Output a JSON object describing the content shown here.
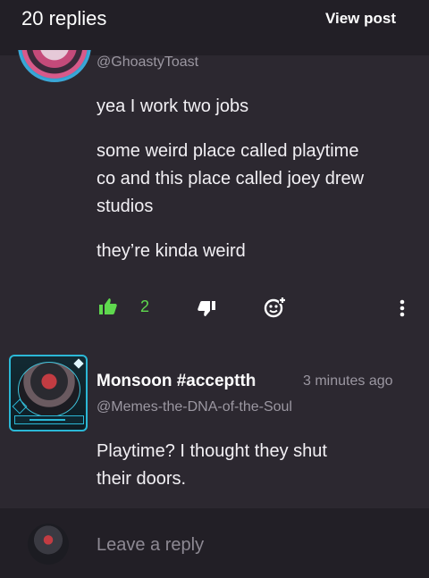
{
  "header": {
    "reply_count": "20 replies",
    "view_post_label": "View post"
  },
  "comment_1": {
    "handle": "@GhoastyToast",
    "paragraphs": [
      "yea I work two jobs",
      "some weird place called playtime",
      "co and this place called joey drew",
      "studios",
      "they’re kinda weird"
    ],
    "like_count": "2",
    "icons": [
      "thumbs-up-icon",
      "thumbs-down-icon",
      "add-reaction-icon",
      "more-options-icon"
    ],
    "accent_color": "#5fd84e"
  },
  "comment_2": {
    "author": "Monsoon #acceptth",
    "time": "3 minutes ago",
    "handle": "@Memes-the-DNA-of-the-Soul",
    "lines": [
      "Playtime? I thought they shut",
      "their doors."
    ]
  },
  "reply_bar": {
    "placeholder": "Leave a reply"
  }
}
